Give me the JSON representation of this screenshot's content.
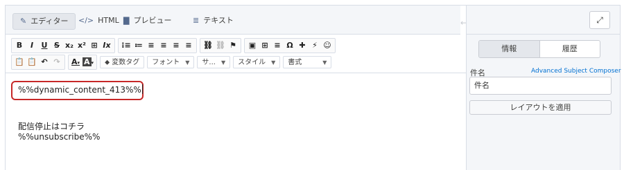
{
  "mode_tabs": [
    {
      "label": "エディター",
      "icon": "pencil-square-icon"
    },
    {
      "label": "HTML",
      "icon": "code-icon"
    },
    {
      "label": "プレビュー",
      "icon": "document-icon"
    },
    {
      "label": "テキスト",
      "icon": "lines-icon"
    }
  ],
  "toolbar": {
    "row1": [
      [
        "B",
        "I",
        "U",
        "S",
        "x₂",
        "x²",
        "⊞",
        "Ix"
      ],
      [
        "⁝≡",
        "≔",
        "≡",
        "≡",
        "≡",
        "≡"
      ],
      [
        "⛓",
        "⛓",
        "⚑"
      ],
      [
        "▣",
        "⊞",
        "≡",
        "Ω",
        "✚",
        "⚡",
        "☺"
      ]
    ],
    "row2_buttons": [
      "📋",
      "📋",
      "↶",
      "↷"
    ],
    "text_color": "A",
    "bg_color": "A",
    "dropdowns": {
      "variable_tag": "変数タグ",
      "font": "フォント",
      "size": "サ...",
      "style": "スタイル",
      "format": "書式"
    }
  },
  "editor": {
    "line1": "%%dynamic_content_413%%",
    "line2": "配信停止はコチラ",
    "line3": "%%unsubscribe%%"
  },
  "side": {
    "tab_info": "情報",
    "tab_history": "履歴",
    "subject_label": "件名",
    "subject_link": "Advanced Subject Composer",
    "subject_value": "件名",
    "apply_layout": "レイアウトを適用"
  },
  "colors": {
    "highlight_border": "#c62828",
    "link": "#0070d2",
    "panel_bg": "#f4f6f9"
  }
}
